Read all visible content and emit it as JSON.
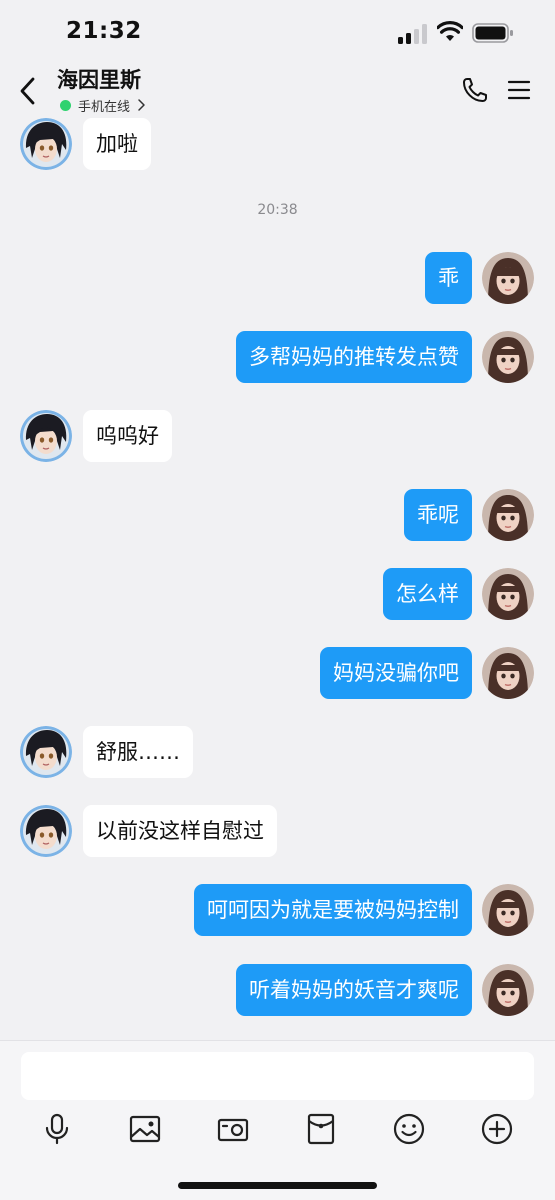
{
  "status_bar": {
    "time": "21:32"
  },
  "header": {
    "contact_name": "海因里斯",
    "online_status": "手机在线"
  },
  "messages": [
    {
      "side": "in",
      "text": "加啦"
    },
    {
      "side": "time",
      "text": "20:38"
    },
    {
      "side": "out",
      "text": "乖"
    },
    {
      "side": "out",
      "text": "多帮妈妈的推转发点赞"
    },
    {
      "side": "in",
      "text": "呜呜好"
    },
    {
      "side": "out",
      "text": "乖呢"
    },
    {
      "side": "out",
      "text": "怎么样"
    },
    {
      "side": "out",
      "text": "妈妈没骗你吧"
    },
    {
      "side": "in",
      "text": "舒服……"
    },
    {
      "side": "in",
      "text": "以前没这样自慰过"
    },
    {
      "side": "out",
      "text": "呵呵因为就是要被妈妈控制"
    },
    {
      "side": "out",
      "text": "听着妈妈的妖音才爽呢"
    }
  ],
  "composer": {
    "placeholder": "",
    "tools": [
      "microphone-icon",
      "image-icon",
      "camera-icon",
      "red-packet-icon",
      "emoji-icon",
      "plus-icon"
    ]
  },
  "colors": {
    "outgoing_bubble": "#1e9bf7",
    "incoming_bubble": "#ffffff",
    "background": "#f1f1f3",
    "online_dot": "#2fd26f"
  }
}
